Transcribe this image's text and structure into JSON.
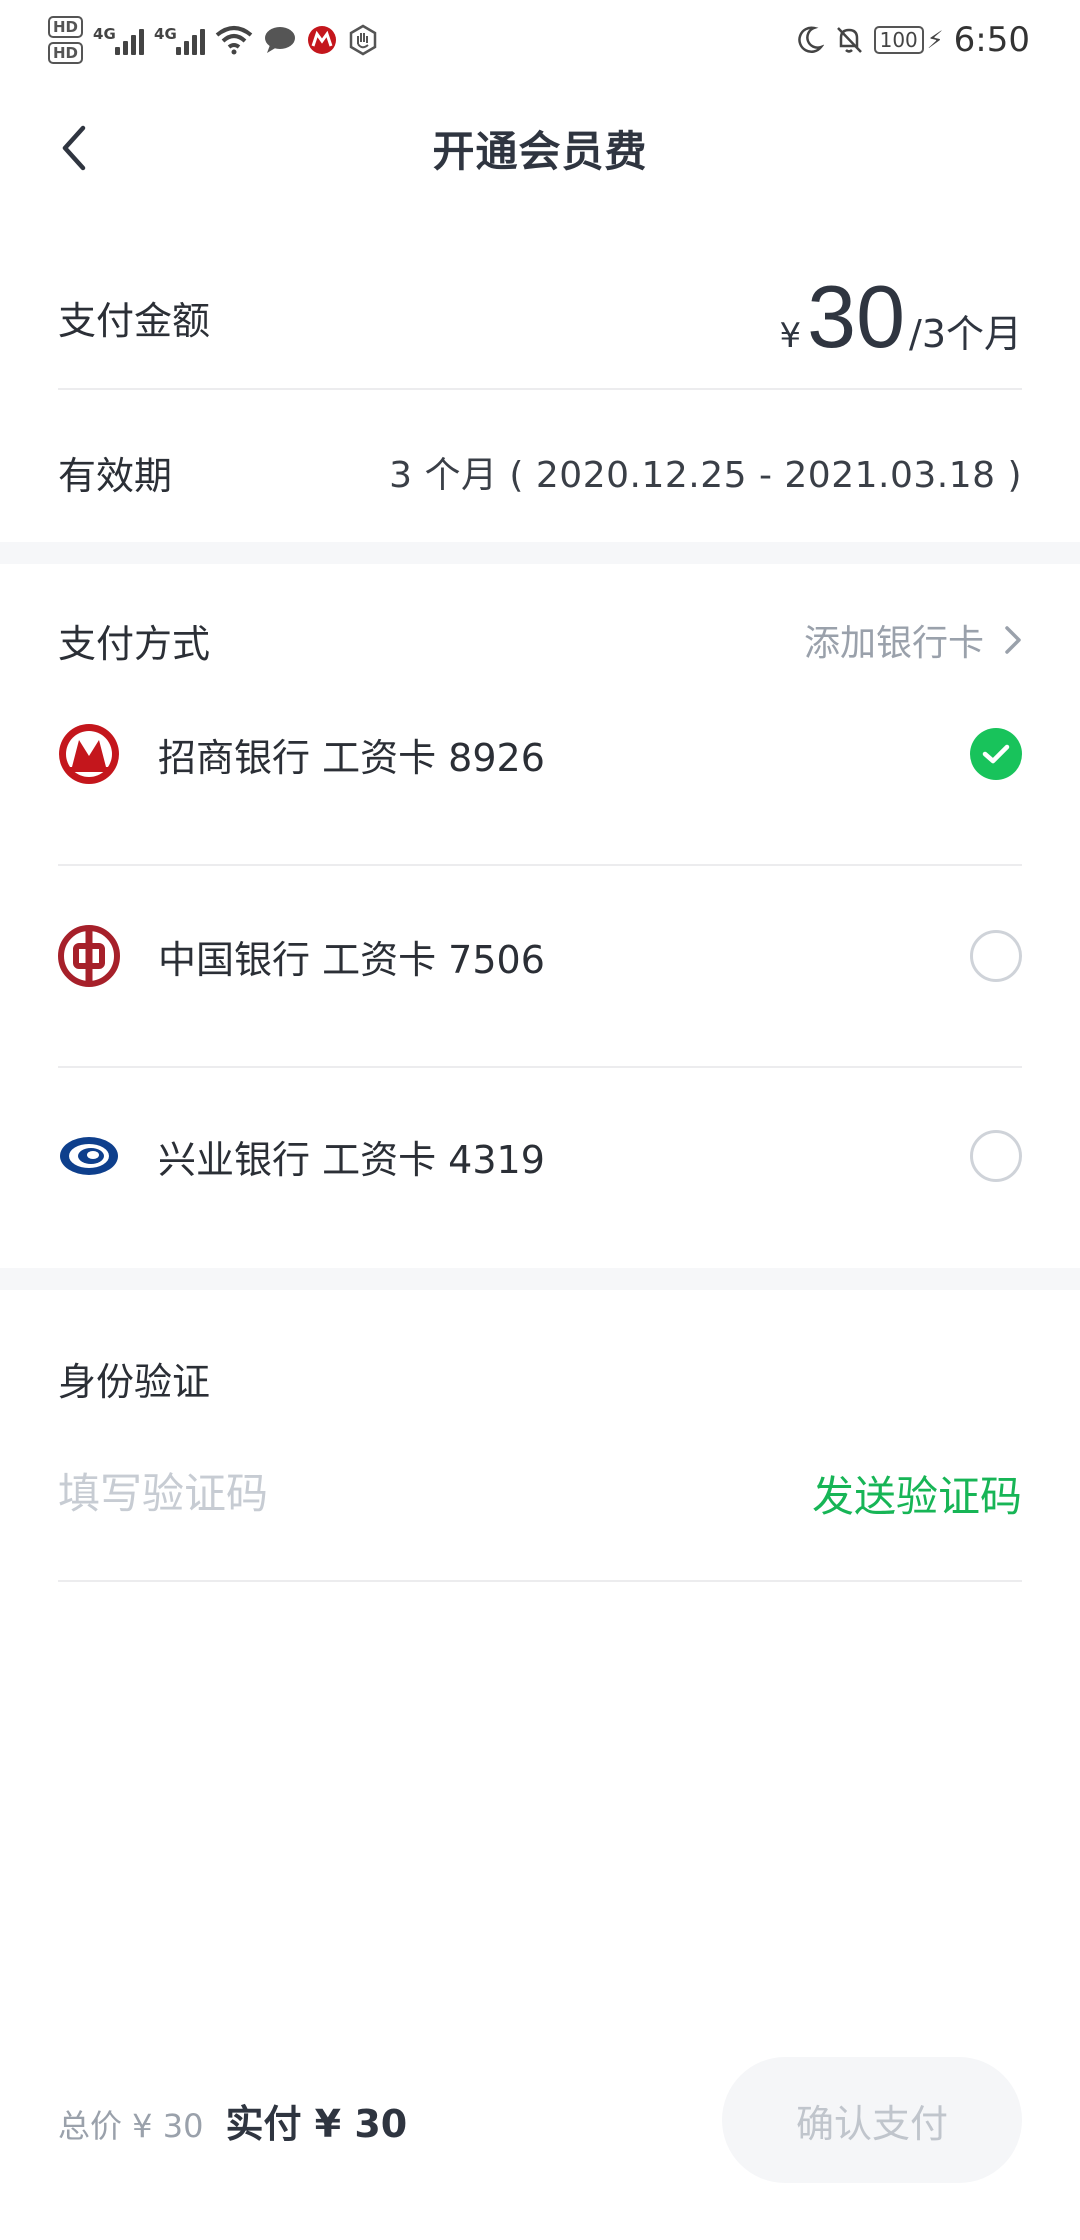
{
  "status_bar": {
    "hd1": "HD",
    "hd2": "HD",
    "sim1_label": "4G",
    "sim2_label": "4G",
    "battery": "100",
    "time": "6:50",
    "icons": [
      "hd-icon",
      "signal-icon",
      "wifi-icon",
      "chat-icon",
      "cmb-app-icon",
      "hand-icon",
      "moon-icon",
      "bell-off-icon",
      "battery-icon",
      "charging-icon"
    ]
  },
  "header": {
    "title": "开通会员费"
  },
  "payment_amount": {
    "label": "支付金额",
    "currency": "¥",
    "value": "30",
    "unit": "/3个月"
  },
  "validity": {
    "label": "有效期",
    "value": "3 个月 ( 2020.12.25 - 2021.03.18 )"
  },
  "payment_method": {
    "label": "支付方式",
    "add_card": "添加银行卡",
    "cards": [
      {
        "name": "招商银行 工资卡 8926",
        "selected": true,
        "logo": "cmb-logo-icon"
      },
      {
        "name": "中国银行 工资卡 7506",
        "selected": false,
        "logo": "boc-logo-icon"
      },
      {
        "name": "兴业银行 工资卡 4319",
        "selected": false,
        "logo": "cib-logo-icon"
      }
    ]
  },
  "verification": {
    "label": "身份验证",
    "placeholder": "填写验证码",
    "send_code": "发送验证码"
  },
  "footer": {
    "total": "总价 ¥ 30",
    "paid": "实付 ¥ 30",
    "confirm": "确认支付"
  },
  "colors": {
    "accent_green": "#18c35b",
    "muted_text": "#9aa1ab",
    "title_text": "#2f3540"
  }
}
